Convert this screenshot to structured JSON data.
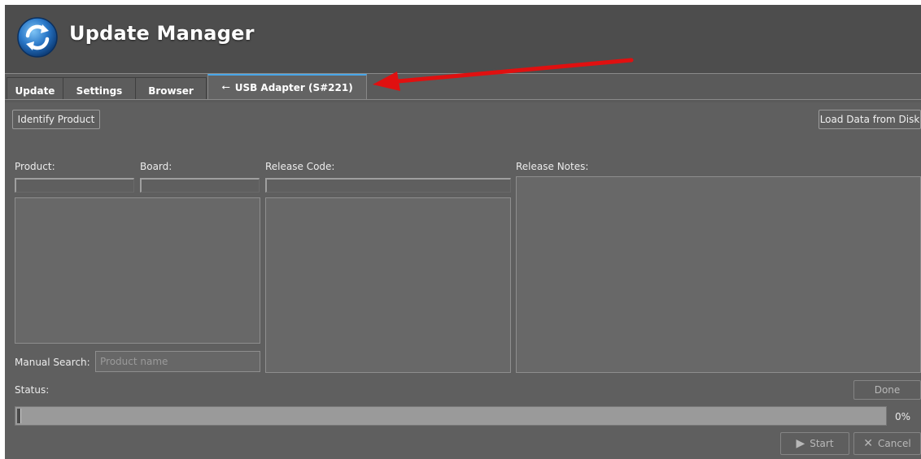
{
  "app": {
    "title": "Update Manager",
    "logo_icon": "refresh-icon"
  },
  "tabs": [
    {
      "label": "Update",
      "active": false
    },
    {
      "label": "Settings",
      "active": false
    },
    {
      "label": "Browser",
      "active": false
    },
    {
      "label": "USB Adapter (S#221)",
      "active": true,
      "icon": "usb-icon",
      "icon_glyph": "⭠"
    }
  ],
  "toolbar": {
    "identify_label": "Identify Product",
    "load_label": "Load Data from Disk"
  },
  "fields": {
    "product_label": "Product:",
    "board_label": "Board:",
    "release_code_label": "Release Code:",
    "release_notes_label": "Release Notes:"
  },
  "search": {
    "label": "Manual Search:",
    "placeholder": "Product name",
    "value": ""
  },
  "status": {
    "label": "Status:",
    "done_label": "Done",
    "progress_percent": 0,
    "progress_text": "0%"
  },
  "actions": {
    "start_label": "Start",
    "start_icon": "play-icon",
    "cancel_label": "Cancel",
    "cancel_icon": "x-icon"
  },
  "colors": {
    "accent": "#49a6e8",
    "annotation_arrow": "#e01010",
    "background": "#5f5f5f"
  }
}
